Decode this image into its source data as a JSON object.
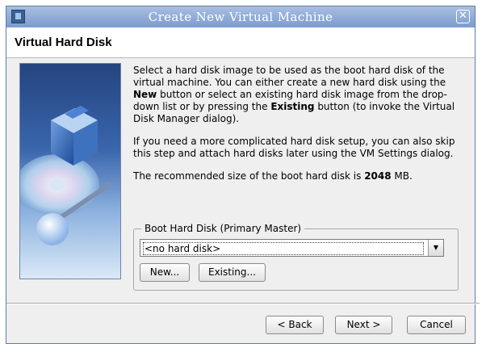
{
  "window": {
    "title": "Create New Virtual Machine",
    "close_glyph": "✕",
    "app_icon": "virtualbox-icon"
  },
  "header": {
    "title": "Virtual Hard Disk"
  },
  "body": {
    "para1_a": "Select a hard disk image to be used as the boot hard disk of the virtual machine. You can either create a new hard disk using the ",
    "para1_b": "New",
    "para1_c": " button or select an existing hard disk image from the drop-down list or by pressing the ",
    "para1_d": "Existing",
    "para1_e": " button (to invoke the Virtual Disk Manager dialog).",
    "para2": "If you need a more complicated hard disk setup, you can also skip this step and attach hard disks later using the VM Settings dialog.",
    "para3_a": "The recommended size of the boot hard disk is ",
    "para3_b": "2048",
    "para3_c": " MB."
  },
  "boot_disk": {
    "legend": "Boot Hard Disk (Primary Master)",
    "selected": "<no hard disk>",
    "arrow_glyph": "▼",
    "new_label": "New...",
    "existing_label": "Existing..."
  },
  "footer": {
    "back_label": "< Back",
    "next_label": "Next >",
    "cancel_label": "Cancel"
  },
  "colors": {
    "titlebar": "#7b9bcf",
    "window_bg": "#efefef",
    "header_bg": "#ffffff"
  }
}
